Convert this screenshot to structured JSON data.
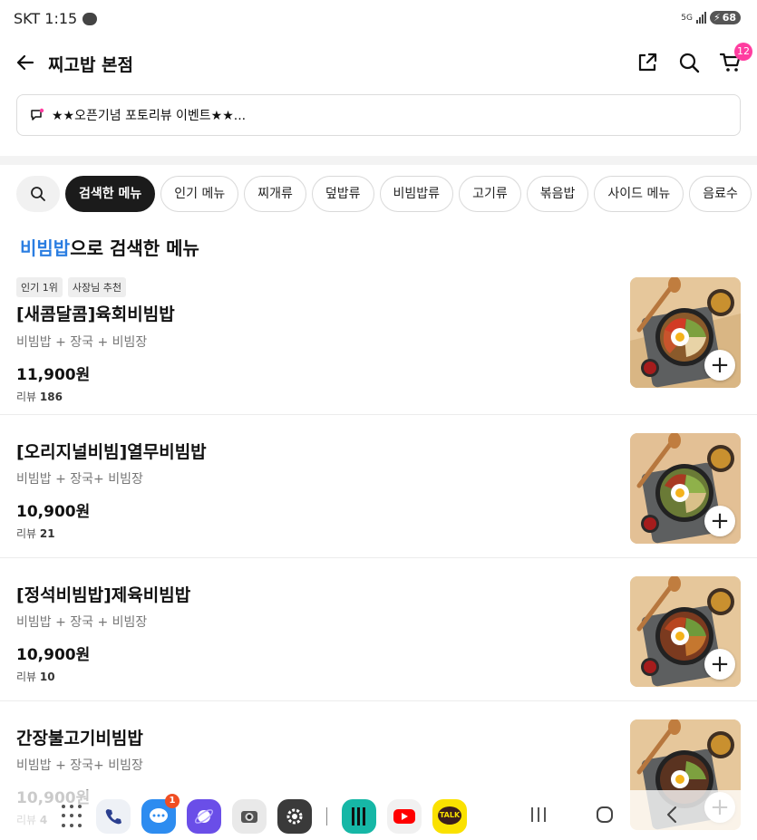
{
  "status_bar": {
    "carrier_time": "SKT 1:15",
    "network": "5G",
    "battery": "68"
  },
  "header": {
    "title": "찌고밥 본점",
    "cart_count": "12"
  },
  "notice": {
    "text": "★★오픈기념 포토리뷰 이벤트★★..."
  },
  "categories": [
    "검색한 메뉴",
    "인기 메뉴",
    "찌개류",
    "덮밥류",
    "비빔밥류",
    "고기류",
    "볶음밥",
    "사이드 메뉴",
    "음료수"
  ],
  "result": {
    "keyword": "비빔밥",
    "suffix": "으로 검색한 메뉴"
  },
  "items": [
    {
      "tags": [
        "인기 1위",
        "사장님 추천"
      ],
      "name": "[새콤달콤]육회비빔밥",
      "desc": "비빔밥 + 장국 + 비빔장",
      "price": "11,900원",
      "review_label": "리뷰",
      "review_count": "186"
    },
    {
      "tags": [],
      "name": "[오리지널비빔]열무비빔밥",
      "desc": "비빔밥 + 장국+ 비빔장",
      "price": "10,900원",
      "review_label": "리뷰",
      "review_count": "21"
    },
    {
      "tags": [],
      "name": "[정석비빔밥]제육비빔밥",
      "desc": "비빔밥 + 장국 + 비빔장",
      "price": "10,900원",
      "review_label": "리뷰",
      "review_count": "10"
    },
    {
      "tags": [],
      "name": "간장불고기비빔밥",
      "desc": "비빔밥 + 장국+ 비빔장",
      "price": "10,900원",
      "review_label": "리뷰",
      "review_count": "4"
    }
  ],
  "dock": {
    "messages_badge": "1",
    "kakao_label": "TALK"
  },
  "colors": {
    "accent": "#2a7de1",
    "badge": "#ff3da0",
    "chip_active": "#1b1b1b"
  }
}
